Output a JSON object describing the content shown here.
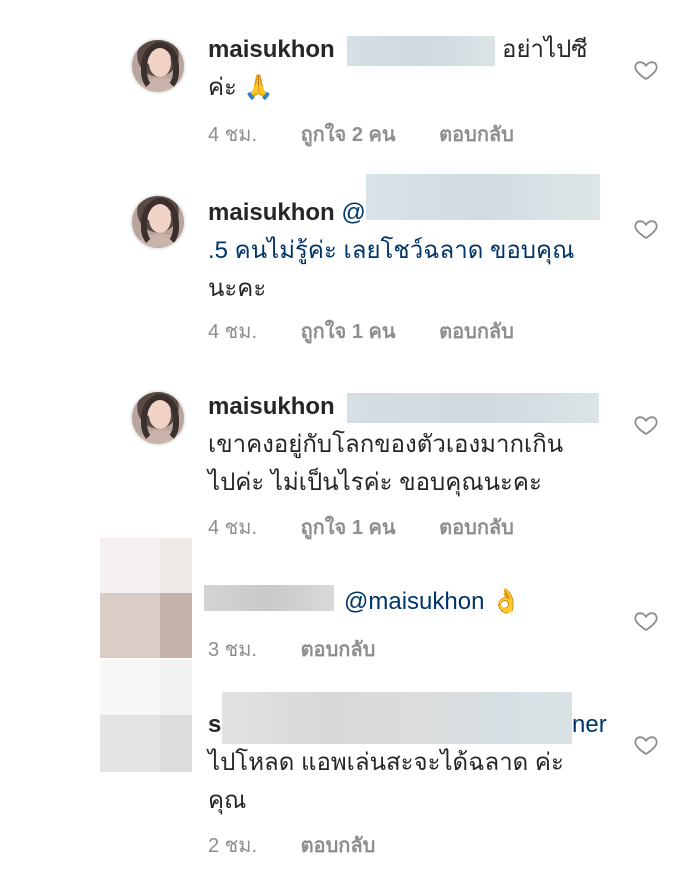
{
  "comments": [
    {
      "username": "maisukhon",
      "text_line1": "อย่าไปซี",
      "text_line2": "ค่ะ 🙏",
      "time": "4 ชม.",
      "likes": "ถูกใจ 2 คน",
      "reply": "ตอบกลับ"
    },
    {
      "username": "maisukhon",
      "mention_prefix": "@",
      "text_line1": ".5 คนไม่รู้ค่ะ เลยโชว์ฉลาด ขอบคุณ",
      "text_line2": "นะคะ",
      "time": "4 ชม.",
      "likes": "ถูกใจ 1 คน",
      "reply": "ตอบกลับ"
    },
    {
      "username": "maisukhon",
      "text_line1": "เขาคงอยู่กับโลกของตัวเองมากเกิน",
      "text_line2": "ไปค่ะ ไม่เป็นไรค่ะ ขอบคุณนะคะ",
      "time": "4 ชม.",
      "likes": "ถูกใจ 1 คน",
      "reply": "ตอบกลับ"
    },
    {
      "mention": "@maisukhon",
      "emoji": "👌",
      "time": "3 ชม.",
      "reply": "ตอบกลับ"
    },
    {
      "username_fragment": "s",
      "mention_fragment": "ner",
      "text_line1": "ไปโหลด แอพเล่นสะจะได้ฉลาด ค่ะ",
      "text_line2": "คุณ",
      "time": "2 ชม.",
      "reply": "ตอบกลับ"
    }
  ],
  "colors": {
    "text": "#262626",
    "secondary": "#8e8e8e",
    "mention": "#003569"
  },
  "icons": {
    "like": "heart-outline-icon"
  }
}
